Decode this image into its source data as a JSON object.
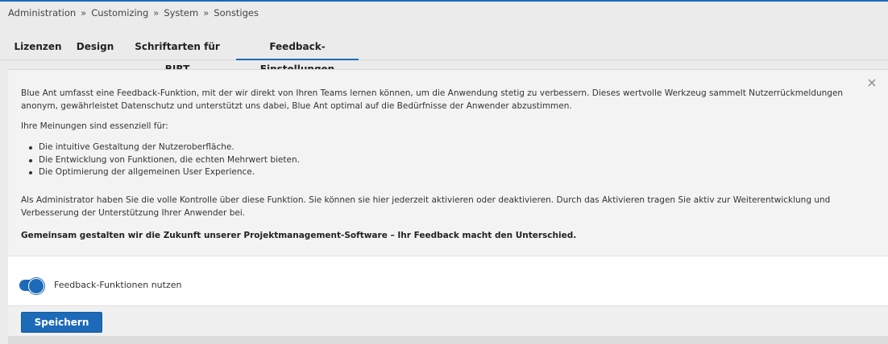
{
  "breadcrumb": {
    "items": [
      "Administration",
      "Customizing",
      "System",
      "Sonstiges"
    ],
    "separator": "»"
  },
  "tabs": [
    {
      "label": "Lizenzen",
      "active": false
    },
    {
      "label": "Design",
      "active": false
    },
    {
      "label": "Schriftarten für BIRT",
      "active": false
    },
    {
      "label": "Feedback-Einstellungen",
      "active": true
    }
  ],
  "info": {
    "intro": "Blue Ant umfasst eine Feedback-Funktion, mit der wir direkt von Ihren Teams lernen können, um die Anwendung stetig zu verbessern. Dieses wertvolle Werkzeug sammelt Nutzerrückmeldungen anonym, gewährleistet Datenschutz und unterstützt uns dabei, Blue Ant optimal auf die Bedürfnisse der Anwender abzustimmen.",
    "lead": "Ihre Meinungen sind essenziell für:",
    "bullets": [
      "Die intuitive Gestaltung der Nutzeroberfläche.",
      "Die Entwicklung von Funktionen, die echten Mehrwert bieten.",
      "Die Optimierung der allgemeinen User Experience."
    ],
    "admin_text": "Als Administrator haben Sie die volle Kontrolle über diese Funktion. Sie können sie hier jederzeit aktivieren oder deaktivieren. Durch das Aktivieren tragen Sie aktiv zur Weiterentwicklung und Verbesserung der Unterstützung Ihrer Anwender bei.",
    "closing": "Gemeinsam gestalten wir die Zukunft unserer Projektmanagement-Software – Ihr Feedback macht den Unterschied.",
    "close_glyph": "×"
  },
  "feedback_toggle": {
    "label": "Feedback-Funktionen nutzen",
    "enabled": true
  },
  "footer": {
    "save_label": "Speichern"
  },
  "colors": {
    "accent": "#1d6ab8",
    "panel": "#f3f3f3",
    "background": "#ebebeb"
  }
}
